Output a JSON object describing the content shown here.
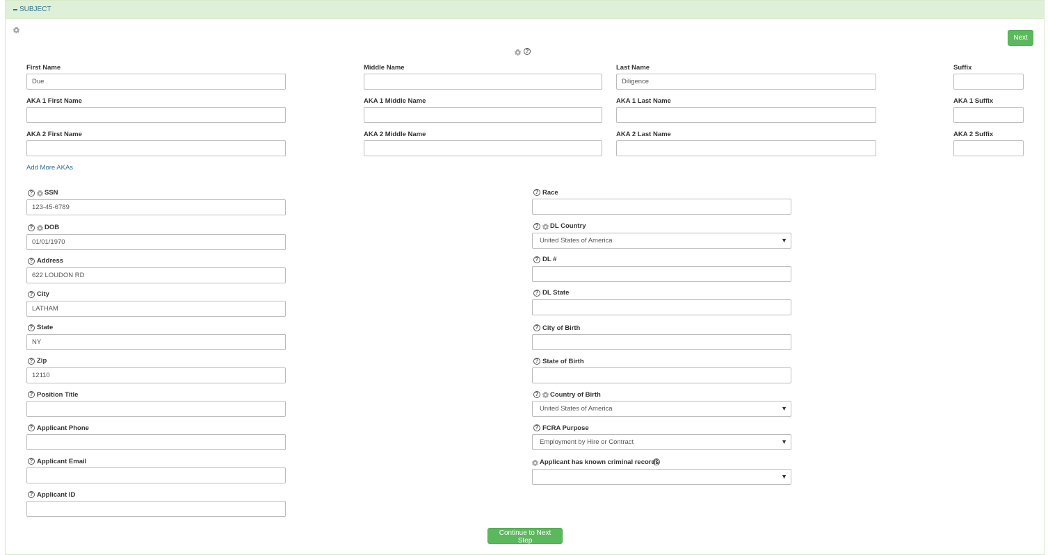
{
  "section": {
    "title": "SUBJECT"
  },
  "buttons": {
    "next": "Next",
    "continue": "Continue to Next Step"
  },
  "names": {
    "first_name": {
      "label": "First Name",
      "value": "Due"
    },
    "middle_name": {
      "label": "Middle Name",
      "value": ""
    },
    "last_name": {
      "label": "Last Name",
      "value": "Diligence"
    },
    "suffix": {
      "label": "Suffix",
      "value": ""
    },
    "aka1_first": {
      "label": "AKA 1 First Name",
      "value": ""
    },
    "aka1_middle": {
      "label": "AKA 1 Middle Name",
      "value": ""
    },
    "aka1_last": {
      "label": "AKA 1 Last Name",
      "value": ""
    },
    "aka1_suffix": {
      "label": "AKA 1 Suffix",
      "value": ""
    },
    "aka2_first": {
      "label": "AKA 2 First Name",
      "value": ""
    },
    "aka2_middle": {
      "label": "AKA 2 Middle Name",
      "value": ""
    },
    "aka2_last": {
      "label": "AKA 2 Last Name",
      "value": ""
    },
    "aka2_suffix": {
      "label": "AKA 2 Suffix",
      "value": ""
    },
    "add_more_akas": "Add More AKAs"
  },
  "left": {
    "ssn": {
      "label": "SSN",
      "value": "123-45-6789"
    },
    "dob": {
      "label": "DOB",
      "value": "01/01/1970"
    },
    "address": {
      "label": "Address",
      "value": "622 LOUDON RD"
    },
    "city": {
      "label": "City",
      "value": "LATHAM"
    },
    "state": {
      "label": "State",
      "value": "NY"
    },
    "zip": {
      "label": "Zip",
      "value": "12110"
    },
    "position_title": {
      "label": "Position Title",
      "value": ""
    },
    "applicant_phone": {
      "label": "Applicant Phone",
      "value": ""
    },
    "applicant_email": {
      "label": "Applicant Email",
      "value": ""
    },
    "applicant_id": {
      "label": "Applicant ID",
      "value": ""
    }
  },
  "right": {
    "race": {
      "label": "Race",
      "value": ""
    },
    "dl_country": {
      "label": "DL Country",
      "value": "United States of America"
    },
    "dl_number": {
      "label": "DL #",
      "value": ""
    },
    "dl_state": {
      "label": "DL  State",
      "value": ""
    },
    "city_of_birth": {
      "label": "City of Birth",
      "value": ""
    },
    "state_of_birth": {
      "label": "State of Birth",
      "value": ""
    },
    "country_of_birth": {
      "label": "Country of Birth",
      "value": "United States of America"
    },
    "fcra_purpose": {
      "label": "FCRA Purpose",
      "value": "Employment by Hire or Contract"
    },
    "criminal_records": {
      "label": "Applicant has known criminal records",
      "value": ""
    }
  },
  "icons": {
    "help": "?",
    "caret": "▼"
  }
}
